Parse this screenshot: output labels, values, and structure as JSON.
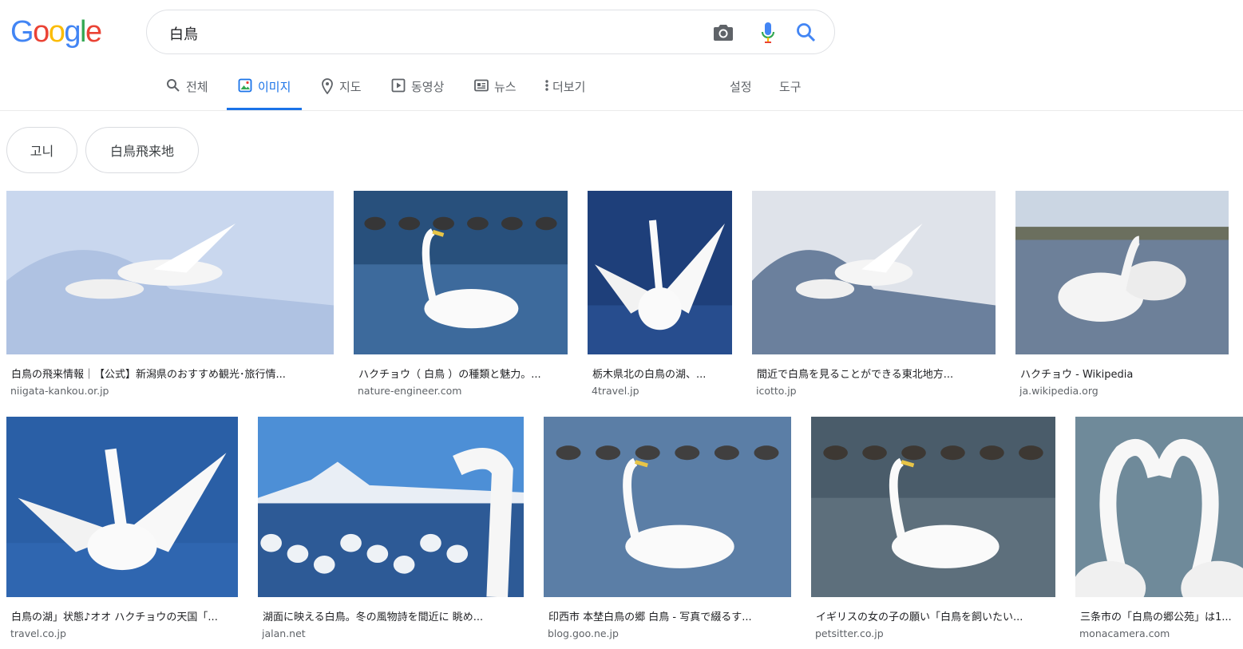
{
  "logo": {
    "letters": [
      "G",
      "o",
      "o",
      "g",
      "l",
      "e"
    ],
    "colors": [
      "#4285F4",
      "#EA4335",
      "#FBBC05",
      "#4285F4",
      "#34A853",
      "#EA4335"
    ]
  },
  "search": {
    "value": "白鳥",
    "camera_icon": "camera-icon",
    "mic_icon": "mic-icon",
    "search_icon": "search-icon"
  },
  "tabs": [
    {
      "label": "전체",
      "icon": "search-icon",
      "active": false
    },
    {
      "label": "이미지",
      "icon": "image-icon",
      "active": true
    },
    {
      "label": "지도",
      "icon": "map-pin-icon",
      "active": false
    },
    {
      "label": "동영상",
      "icon": "play-icon",
      "active": false
    },
    {
      "label": "뉴스",
      "icon": "news-icon",
      "active": false
    },
    {
      "label": "더보기",
      "icon": "more-vertical-icon",
      "active": false
    }
  ],
  "tools": {
    "settings": "설정",
    "tools": "도구"
  },
  "chips": [
    "고니",
    "白鳥飛来地"
  ],
  "results": [
    {
      "title": "白鳥の飛来情報｜【公式】新潟県のおすすめ観光･旅行情...",
      "source": "niigata-kankou.or.jp"
    },
    {
      "title": "ハクチョウ（ 白鳥 ）の種類と魅力。...",
      "source": "nature-engineer.com"
    },
    {
      "title": "栃木県北の白鳥の湖、...",
      "source": "4travel.jp"
    },
    {
      "title": "間近で白鳥を見ることができる東北地方...",
      "source": "icotto.jp"
    },
    {
      "title": "ハクチョウ - Wikipedia",
      "source": "ja.wikipedia.org"
    },
    {
      "title": "白鳥の湖」状態♪オオ ハクチョウの天国「...",
      "source": "travel.co.jp"
    },
    {
      "title": "湖面に映える白鳥。冬の風物詩を間近に 眺め...",
      "source": "jalan.net"
    },
    {
      "title": "印西市 本埜白鳥の郷 白鳥 - 写真で綴るす...",
      "source": "blog.goo.ne.jp"
    },
    {
      "title": "イギリスの女の子の願い「白鳥を飼いたい...",
      "source": "petsitter.co.jp"
    },
    {
      "title": "三条市の「白鳥の郷公苑」は1...",
      "source": "monacamera.com"
    }
  ]
}
